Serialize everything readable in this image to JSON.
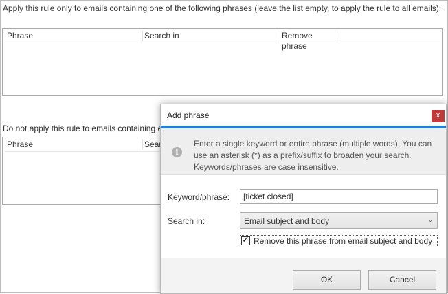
{
  "intro_text": "Apply this rule only to emails containing one of the following phrases (leave the list empty, to apply the rule to all emails):",
  "top_table": {
    "columns": [
      "Phrase",
      "Search in",
      "Remove phrase"
    ]
  },
  "lower_label": "Do not apply this rule to emails containing e",
  "lower_table": {
    "columns": [
      "Phrase",
      "Searc"
    ]
  },
  "dialog": {
    "title": "Add phrase",
    "close_label": "x",
    "info_icon_glyph": "i",
    "info_text": "Enter a single keyword or entire phrase (multiple words). You can use an asterisk (*) as a prefix/suffix to broaden your search. Keywords/phrases are case insensitive.",
    "keyword_label": "Keyword/phrase:",
    "keyword_value": "[ticket closed]",
    "search_in_label": "Search in:",
    "search_in_value": "Email subject and body",
    "remove_label": "Remove this phrase from email subject and body",
    "remove_checked": true,
    "ok_label": "OK",
    "cancel_label": "Cancel"
  },
  "colors": {
    "accent": "#1f7ed6",
    "close_button": "#c13b3b",
    "info_background": "#eeeeee"
  }
}
